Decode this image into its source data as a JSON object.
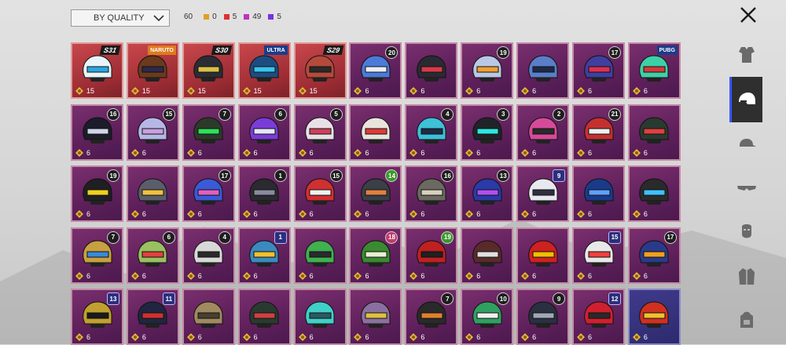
{
  "toolbar": {
    "sort_label": "BY QUALITY",
    "total": "60",
    "counts": [
      {
        "color": "#e0a020",
        "value": "0"
      },
      {
        "color": "#e03030",
        "value": "5"
      },
      {
        "color": "#c030c0",
        "value": "49"
      },
      {
        "color": "#7a30e0",
        "value": "5"
      }
    ]
  },
  "sidebar": [
    "outfit-icon",
    "helmet-icon",
    "cap-icon",
    "glasses-icon",
    "mask-icon",
    "jacket-icon",
    "backpack-icon"
  ],
  "items": [
    {
      "tier": "red",
      "tag": "season",
      "label": "S31",
      "value": "15",
      "hc": "#e8f4f7",
      "vc": "#2ba6e0"
    },
    {
      "tier": "red",
      "tag": "collab",
      "label": "NARUTO",
      "value": "15",
      "hc": "#6b3a1d",
      "vc": "#2d2a4c"
    },
    {
      "tier": "red",
      "tag": "season",
      "label": "S30",
      "value": "15",
      "hc": "#2c2d34",
      "vc": "#d8c14a"
    },
    {
      "tier": "red",
      "tag": "collab",
      "label": "ULTRA",
      "value": "15",
      "hc": "#1d4d80",
      "vc": "#3ac3f0"
    },
    {
      "tier": "red",
      "tag": "season",
      "label": "S29",
      "value": "15",
      "hc": "#b54a3a",
      "vc": "#2a2a2a"
    },
    {
      "tier": "purple",
      "tag": "badge",
      "label": "20",
      "value": "6",
      "hc": "#4b7bd8",
      "vc": "#e8eef8"
    },
    {
      "tier": "purple",
      "tag": "none",
      "label": "",
      "value": "6",
      "hc": "#2a2a33",
      "vc": "#d93a4a"
    },
    {
      "tier": "purple",
      "tag": "badge",
      "label": "19",
      "value": "6",
      "hc": "#b9c8e4",
      "vc": "#f0a030"
    },
    {
      "tier": "purple",
      "tag": "none",
      "label": "",
      "value": "6",
      "hc": "#5a7ec8",
      "vc": "#1f2a48"
    },
    {
      "tier": "purple",
      "tag": "badge",
      "label": "17",
      "value": "6",
      "hc": "#3f3fa0",
      "vc": "#e03050"
    },
    {
      "tier": "purple",
      "tag": "collab",
      "label": "PUBG",
      "value": "6",
      "hc": "#3dd1a7",
      "vc": "#d83a3a"
    },
    {
      "tier": "purple",
      "tag": "badge",
      "label": "16",
      "value": "6",
      "hc": "#1c1c2a",
      "vc": "#d0d6ea"
    },
    {
      "tier": "purple",
      "tag": "badge",
      "label": "15",
      "value": "6",
      "hc": "#b7b7e6",
      "vc": "#c8a0e0"
    },
    {
      "tier": "purple",
      "tag": "badge",
      "label": "7",
      "value": "6",
      "hc": "#2d3a2a",
      "vc": "#2ee05a"
    },
    {
      "tier": "purple",
      "tag": "badge",
      "label": "6",
      "value": "6",
      "hc": "#7a3cd8",
      "vc": "#e6e6ff"
    },
    {
      "tier": "purple",
      "tag": "badge",
      "label": "5",
      "value": "6",
      "hc": "#e8e0e6",
      "vc": "#d0405a"
    },
    {
      "tier": "purple",
      "tag": "none",
      "label": "",
      "value": "6",
      "hc": "#e8e4dc",
      "vc": "#e03a3a"
    },
    {
      "tier": "purple",
      "tag": "badge",
      "label": "4",
      "value": "6",
      "hc": "#3ec0d8",
      "vc": "#1d2a48"
    },
    {
      "tier": "purple",
      "tag": "badge",
      "label": "3",
      "value": "6",
      "hc": "#202428",
      "vc": "#2ee8e0"
    },
    {
      "tier": "purple",
      "tag": "badge",
      "label": "2",
      "value": "6",
      "hc": "#d64a9a",
      "vc": "#2a2a2a"
    },
    {
      "tier": "purple",
      "tag": "badge",
      "label": "21",
      "value": "6",
      "hc": "#c43030",
      "vc": "#f0f0f0"
    },
    {
      "tier": "purple",
      "tag": "none",
      "label": "",
      "value": "6",
      "hc": "#2a3a30",
      "vc": "#e04040"
    },
    {
      "tier": "purple",
      "tag": "badge",
      "label": "19",
      "value": "6",
      "hc": "#1f1f24",
      "vc": "#f0d020"
    },
    {
      "tier": "purple",
      "tag": "none",
      "label": "",
      "value": "6",
      "hc": "#5a5e6a",
      "vc": "#f0c040"
    },
    {
      "tier": "purple",
      "tag": "badge",
      "label": "17",
      "value": "6",
      "hc": "#3a5ad8",
      "vc": "#e060c0"
    },
    {
      "tier": "purple",
      "tag": "badge",
      "label": "1",
      "value": "6",
      "hc": "#2a2a30",
      "vc": "#8a8aa0"
    },
    {
      "tier": "purple",
      "tag": "badge",
      "label": "15",
      "value": "6",
      "hc": "#d03030",
      "vc": "#f0f0f0"
    },
    {
      "tier": "purple",
      "tag": "badge green",
      "label": "14",
      "value": "6",
      "hc": "#3a3f48",
      "vc": "#e08040"
    },
    {
      "tier": "purple",
      "tag": "badge",
      "label": "16",
      "value": "6",
      "hc": "#6a6a60",
      "vc": "#d8d0c0"
    },
    {
      "tier": "purple",
      "tag": "badge",
      "label": "13",
      "value": "6",
      "hc": "#2a3aa8",
      "vc": "#b050f0"
    },
    {
      "tier": "purple",
      "tag": "badge hex",
      "label": "9",
      "value": "6",
      "hc": "#e8e8f0",
      "vc": "#303040"
    },
    {
      "tier": "purple",
      "tag": "none",
      "label": "",
      "value": "6",
      "hc": "#1a3a8a",
      "vc": "#60a0ff"
    },
    {
      "tier": "purple",
      "tag": "none",
      "label": "",
      "value": "6",
      "hc": "#2a2a2a",
      "vc": "#40c0ff"
    },
    {
      "tier": "purple",
      "tag": "badge",
      "label": "7",
      "value": "6",
      "hc": "#c8a040",
      "vc": "#3a8ad8"
    },
    {
      "tier": "purple",
      "tag": "badge",
      "label": "6",
      "value": "6",
      "hc": "#9ac060",
      "vc": "#e04040"
    },
    {
      "tier": "purple",
      "tag": "badge",
      "label": "4",
      "value": "6",
      "hc": "#d8d8d8",
      "vc": "#2a2a2a"
    },
    {
      "tier": "purple",
      "tag": "badge hex",
      "label": "1",
      "value": "6",
      "hc": "#3a8ac0",
      "vc": "#f0c030"
    },
    {
      "tier": "purple",
      "tag": "none",
      "label": "",
      "value": "6",
      "hc": "#40b050",
      "vc": "#2a2a30"
    },
    {
      "tier": "purple",
      "tag": "badge pink",
      "label": "18",
      "value": "6",
      "hc": "#3a8a30",
      "vc": "#e8f0d0"
    },
    {
      "tier": "purple",
      "tag": "badge green",
      "label": "19",
      "value": "6",
      "hc": "#c02020",
      "vc": "#202020"
    },
    {
      "tier": "purple",
      "tag": "none",
      "label": "",
      "value": "6",
      "hc": "#5a2a2a",
      "vc": "#e0e0e0"
    },
    {
      "tier": "purple",
      "tag": "none",
      "label": "",
      "value": "6",
      "hc": "#d02020",
      "vc": "#f0c000"
    },
    {
      "tier": "purple",
      "tag": "badge hex",
      "label": "15",
      "value": "6",
      "hc": "#e8e8e8",
      "vc": "#f04040"
    },
    {
      "tier": "purple",
      "tag": "badge",
      "label": "17",
      "value": "6",
      "hc": "#2a3a8a",
      "vc": "#f0a020"
    },
    {
      "tier": "purple",
      "tag": "badge hex",
      "label": "13",
      "value": "6",
      "hc": "#c0a030",
      "vc": "#1a1a1a"
    },
    {
      "tier": "purple",
      "tag": "badge hex",
      "label": "11",
      "value": "6",
      "hc": "#202640",
      "vc": "#d03030"
    },
    {
      "tier": "purple",
      "tag": "none",
      "label": "",
      "value": "6",
      "hc": "#a08a60",
      "vc": "#4a4030"
    },
    {
      "tier": "purple",
      "tag": "none",
      "label": "",
      "value": "6",
      "hc": "#2a3a30",
      "vc": "#d04040"
    },
    {
      "tier": "purple",
      "tag": "none",
      "label": "",
      "value": "6",
      "hc": "#40d0c8",
      "vc": "#2a5a60"
    },
    {
      "tier": "purple",
      "tag": "none",
      "label": "",
      "value": "6",
      "hc": "#8a70a0",
      "vc": "#e0c040"
    },
    {
      "tier": "purple",
      "tag": "badge",
      "label": "7",
      "value": "6",
      "hc": "#2a2a2a",
      "vc": "#e08030"
    },
    {
      "tier": "purple",
      "tag": "badge",
      "label": "10",
      "value": "6",
      "hc": "#30a060",
      "vc": "#f0f0f0"
    },
    {
      "tier": "purple",
      "tag": "badge",
      "label": "9",
      "value": "6",
      "hc": "#2a3040",
      "vc": "#a0a8b8"
    },
    {
      "tier": "purple",
      "tag": "badge hex",
      "label": "12",
      "value": "6",
      "hc": "#d02030",
      "vc": "#2a2a2a"
    },
    {
      "tier": "blue",
      "tag": "none",
      "label": "",
      "value": "6",
      "hc": "#d03020",
      "vc": "#f0c030"
    }
  ]
}
